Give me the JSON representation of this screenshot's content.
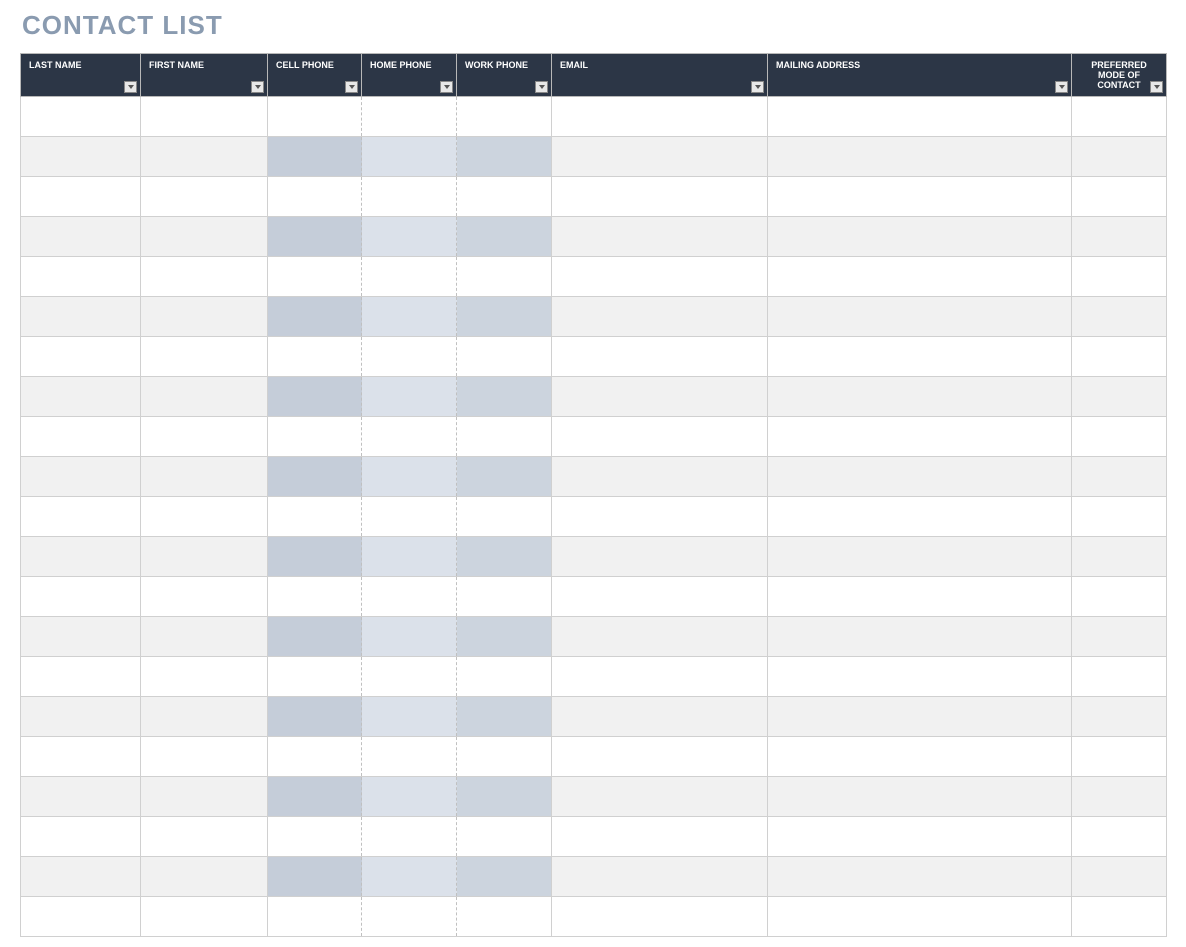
{
  "title": "CONTACT LIST",
  "columns": [
    {
      "key": "last_name",
      "label": "LAST NAME",
      "align": "left",
      "filter": true
    },
    {
      "key": "first_name",
      "label": "FIRST NAME",
      "align": "left",
      "filter": true
    },
    {
      "key": "cell_phone",
      "label": "CELL PHONE",
      "align": "left",
      "filter": true
    },
    {
      "key": "home_phone",
      "label": "HOME PHONE",
      "align": "left",
      "filter": true
    },
    {
      "key": "work_phone",
      "label": "WORK PHONE",
      "align": "left",
      "filter": true
    },
    {
      "key": "email",
      "label": "EMAIL",
      "align": "left",
      "filter": true
    },
    {
      "key": "mailing_address",
      "label": "MAILING ADDRESS",
      "align": "left",
      "filter": true
    },
    {
      "key": "preferred_mode",
      "label": "PREFERRED MODE OF CONTACT",
      "align": "center",
      "filter": true
    }
  ],
  "rows": [
    {
      "last_name": "",
      "first_name": "",
      "cell_phone": "",
      "home_phone": "",
      "work_phone": "",
      "email": "",
      "mailing_address": "",
      "preferred_mode": ""
    },
    {
      "last_name": "",
      "first_name": "",
      "cell_phone": "",
      "home_phone": "",
      "work_phone": "",
      "email": "",
      "mailing_address": "",
      "preferred_mode": ""
    },
    {
      "last_name": "",
      "first_name": "",
      "cell_phone": "",
      "home_phone": "",
      "work_phone": "",
      "email": "",
      "mailing_address": "",
      "preferred_mode": ""
    },
    {
      "last_name": "",
      "first_name": "",
      "cell_phone": "",
      "home_phone": "",
      "work_phone": "",
      "email": "",
      "mailing_address": "",
      "preferred_mode": ""
    },
    {
      "last_name": "",
      "first_name": "",
      "cell_phone": "",
      "home_phone": "",
      "work_phone": "",
      "email": "",
      "mailing_address": "",
      "preferred_mode": ""
    },
    {
      "last_name": "",
      "first_name": "",
      "cell_phone": "",
      "home_phone": "",
      "work_phone": "",
      "email": "",
      "mailing_address": "",
      "preferred_mode": ""
    },
    {
      "last_name": "",
      "first_name": "",
      "cell_phone": "",
      "home_phone": "",
      "work_phone": "",
      "email": "",
      "mailing_address": "",
      "preferred_mode": ""
    },
    {
      "last_name": "",
      "first_name": "",
      "cell_phone": "",
      "home_phone": "",
      "work_phone": "",
      "email": "",
      "mailing_address": "",
      "preferred_mode": ""
    },
    {
      "last_name": "",
      "first_name": "",
      "cell_phone": "",
      "home_phone": "",
      "work_phone": "",
      "email": "",
      "mailing_address": "",
      "preferred_mode": ""
    },
    {
      "last_name": "",
      "first_name": "",
      "cell_phone": "",
      "home_phone": "",
      "work_phone": "",
      "email": "",
      "mailing_address": "",
      "preferred_mode": ""
    },
    {
      "last_name": "",
      "first_name": "",
      "cell_phone": "",
      "home_phone": "",
      "work_phone": "",
      "email": "",
      "mailing_address": "",
      "preferred_mode": ""
    },
    {
      "last_name": "",
      "first_name": "",
      "cell_phone": "",
      "home_phone": "",
      "work_phone": "",
      "email": "",
      "mailing_address": "",
      "preferred_mode": ""
    },
    {
      "last_name": "",
      "first_name": "",
      "cell_phone": "",
      "home_phone": "",
      "work_phone": "",
      "email": "",
      "mailing_address": "",
      "preferred_mode": ""
    },
    {
      "last_name": "",
      "first_name": "",
      "cell_phone": "",
      "home_phone": "",
      "work_phone": "",
      "email": "",
      "mailing_address": "",
      "preferred_mode": ""
    },
    {
      "last_name": "",
      "first_name": "",
      "cell_phone": "",
      "home_phone": "",
      "work_phone": "",
      "email": "",
      "mailing_address": "",
      "preferred_mode": ""
    },
    {
      "last_name": "",
      "first_name": "",
      "cell_phone": "",
      "home_phone": "",
      "work_phone": "",
      "email": "",
      "mailing_address": "",
      "preferred_mode": ""
    },
    {
      "last_name": "",
      "first_name": "",
      "cell_phone": "",
      "home_phone": "",
      "work_phone": "",
      "email": "",
      "mailing_address": "",
      "preferred_mode": ""
    },
    {
      "last_name": "",
      "first_name": "",
      "cell_phone": "",
      "home_phone": "",
      "work_phone": "",
      "email": "",
      "mailing_address": "",
      "preferred_mode": ""
    },
    {
      "last_name": "",
      "first_name": "",
      "cell_phone": "",
      "home_phone": "",
      "work_phone": "",
      "email": "",
      "mailing_address": "",
      "preferred_mode": ""
    },
    {
      "last_name": "",
      "first_name": "",
      "cell_phone": "",
      "home_phone": "",
      "work_phone": "",
      "email": "",
      "mailing_address": "",
      "preferred_mode": ""
    },
    {
      "last_name": "",
      "first_name": "",
      "cell_phone": "",
      "home_phone": "",
      "work_phone": "",
      "email": "",
      "mailing_address": "",
      "preferred_mode": ""
    }
  ]
}
